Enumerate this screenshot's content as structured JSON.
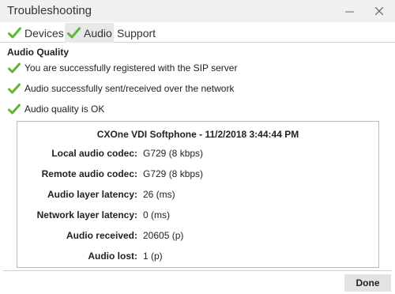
{
  "window": {
    "title": "Troubleshooting",
    "minimize_glyph": "—",
    "close_glyph": "✕"
  },
  "tabs": [
    {
      "label": "Devices",
      "icon": "checkmark-icon",
      "active": false
    },
    {
      "label": "Audio",
      "icon": "checkmark-icon",
      "active": true
    },
    {
      "label": "Support",
      "active": false
    }
  ],
  "audio_quality": {
    "title": "Audio Quality",
    "checks": [
      {
        "text": "You are successfully registered with the SIP server",
        "icon": "checkmark-icon"
      },
      {
        "text": "Audio successfully sent/received over the network",
        "icon": "checkmark-icon"
      },
      {
        "text": "Audio quality is OK",
        "icon": "checkmark-icon"
      }
    ]
  },
  "stats_panel": {
    "title": "CXOne VDI Softphone - 11/2/2018 3:44:44 PM",
    "rows": [
      {
        "label": "Local audio codec:",
        "value": "G729 (8 kbps)"
      },
      {
        "label": "Remote audio codec:",
        "value": "G729 (8 kbps)"
      },
      {
        "label": "Audio layer latency:",
        "value": "26 (ms)"
      },
      {
        "label": "Network layer latency:",
        "value": "0 (ms)"
      },
      {
        "label": "Audio received:",
        "value": "20605 (p)"
      },
      {
        "label": "Audio lost:",
        "value": "1 (p)"
      }
    ]
  },
  "footer": {
    "done_label": "Done"
  },
  "colors": {
    "check_green": "#5cb82f",
    "titlebar_bg": "#f0f0f0",
    "active_tab_bg": "#e8e8e8"
  }
}
